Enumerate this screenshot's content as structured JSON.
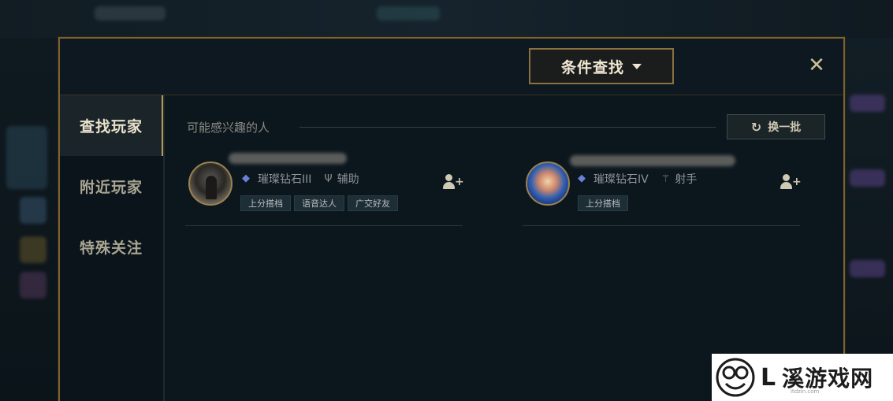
{
  "header": {
    "filter_button": "条件查找",
    "close_glyph": "✕"
  },
  "sidebar": {
    "items": [
      {
        "label": "查找玩家",
        "active": true
      },
      {
        "label": "附近玩家",
        "active": false
      },
      {
        "label": "特殊关注",
        "active": false
      }
    ]
  },
  "main": {
    "section_title": "可能感兴趣的人",
    "refresh_label": "换一批",
    "players": [
      {
        "rank": "璀璨钻石III",
        "role": "辅助",
        "tags": [
          "上分搭档",
          "语音达人",
          "广交好友"
        ]
      },
      {
        "rank": "璀璨钻石IV",
        "role": "射手",
        "tags": [
          "上分搭档"
        ]
      }
    ]
  },
  "watermark": {
    "text": "溪游戏网",
    "url": "itdzin.com"
  },
  "colors": {
    "gold_border": "#7a6332",
    "rank_blue": "#6a7fd9",
    "panel_bg": "#0b161d"
  }
}
